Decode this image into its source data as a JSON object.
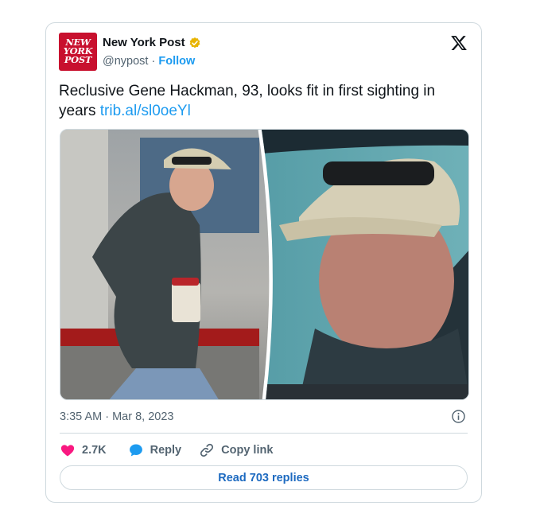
{
  "account": {
    "logo_lines": [
      "NEW",
      "YORK",
      "POST"
    ],
    "name": "New York Post",
    "handle": "@nypost",
    "separator": "·",
    "follow_label": "Follow",
    "verified_color": "#e8b400"
  },
  "tweet": {
    "text": "Reclusive Gene Hackman, 93, looks fit in first sighting in years ",
    "link": "trib.al/sl0oeYl",
    "timestamp": "3:35 AM · Mar 8, 2023"
  },
  "actions": {
    "likes": "2.7K",
    "reply_label": "Reply",
    "copy_link_label": "Copy link",
    "read_replies_label": "Read 703 replies"
  },
  "colors": {
    "accent": "#1d9bf0",
    "like": "#f91880",
    "brand_red": "#c8102e"
  },
  "icons": [
    "x-logo-icon",
    "verified-badge-icon",
    "info-icon",
    "heart-icon",
    "reply-icon",
    "link-icon"
  ]
}
